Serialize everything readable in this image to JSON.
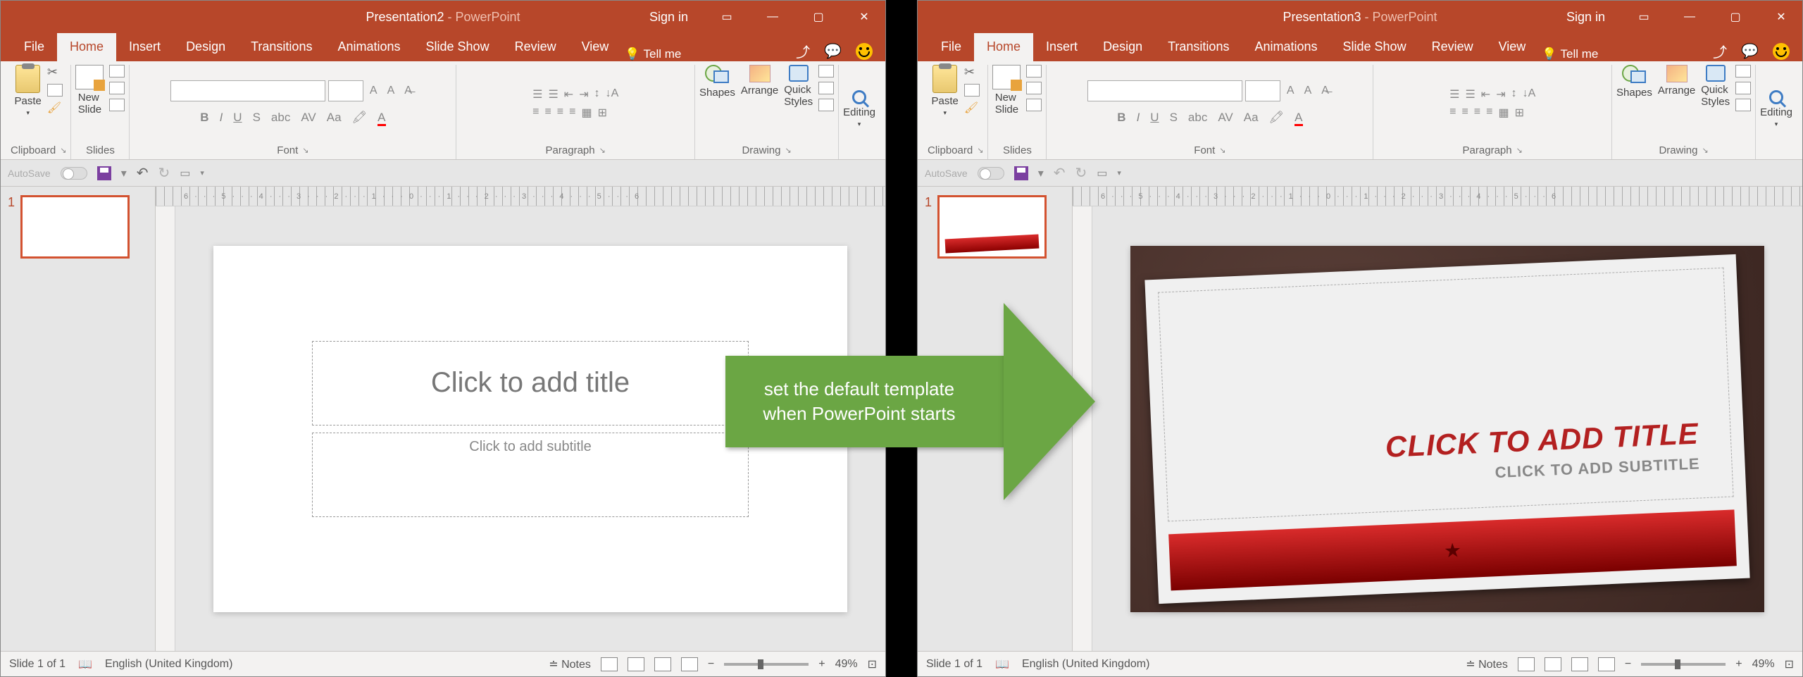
{
  "left": {
    "title": "Presentation2",
    "suffix": " - PowerPoint",
    "signin": "Sign in",
    "tabs": [
      "File",
      "Home",
      "Insert",
      "Design",
      "Transitions",
      "Animations",
      "Slide Show",
      "Review",
      "View"
    ],
    "tellme": "Tell me",
    "groups": {
      "clipboard": "Clipboard",
      "paste": "Paste",
      "newslide": "New\nSlide",
      "slides": "Slides",
      "font": "Font",
      "paragraph": "Paragraph",
      "shapes": "Shapes",
      "arrange": "Arrange",
      "styles": "Quick\nStyles",
      "drawing": "Drawing",
      "editing": "Editing"
    },
    "autosave": "AutoSave",
    "thumbnum": "1",
    "title_ph": "Click to add title",
    "subtitle_ph": "Click to add subtitle",
    "status": {
      "slide": "Slide 1 of 1",
      "lang": "English (United Kingdom)",
      "notes": "Notes",
      "zoom": "49%"
    }
  },
  "right": {
    "title": "Presentation3",
    "suffix": " - PowerPoint",
    "signin": "Sign in",
    "tabs": [
      "File",
      "Home",
      "Insert",
      "Design",
      "Transitions",
      "Animations",
      "Slide Show",
      "Review",
      "View"
    ],
    "tellme": "Tell me",
    "groups": {
      "clipboard": "Clipboard",
      "paste": "Paste",
      "newslide": "New\nSlide",
      "slides": "Slides",
      "font": "Font",
      "paragraph": "Paragraph",
      "shapes": "Shapes",
      "arrange": "Arrange",
      "styles": "Quick\nStyles",
      "drawing": "Drawing",
      "editing": "Editing"
    },
    "autosave": "AutoSave",
    "thumbnum": "1",
    "title_ph": "CLICK TO ADD TITLE",
    "subtitle_ph": "CLICK TO ADD SUBTITLE",
    "status": {
      "slide": "Slide 1 of 1",
      "lang": "English (United Kingdom)",
      "notes": "Notes",
      "zoom": "49%"
    }
  },
  "arrow": {
    "line1": "set the default template",
    "line2": "when PowerPoint starts"
  },
  "ruler": "6 · · · 5 · · · 4 · · · 3 · · · 2 · · · 1 · · · 0 · · · 1 · · · 2 · · · 3 · · · 4 · · · 5 · · · 6"
}
